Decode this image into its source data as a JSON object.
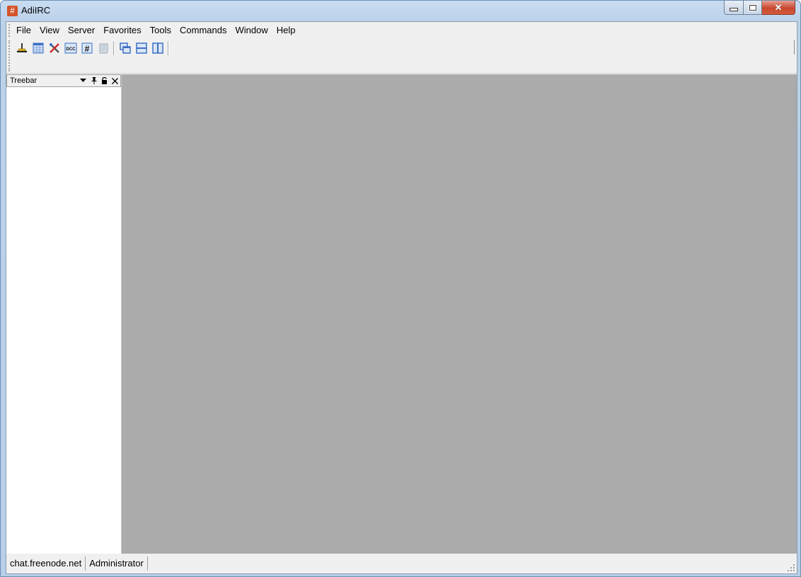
{
  "window": {
    "title": "AdiIRC",
    "app_icon_glyph": "#",
    "caption_buttons": {
      "minimize": "minimize",
      "maximize": "maximize",
      "close": "✕"
    }
  },
  "menubar": {
    "items": [
      "File",
      "View",
      "Server",
      "Favorites",
      "Tools",
      "Commands",
      "Window",
      "Help"
    ]
  },
  "toolbar": {
    "buttons": [
      {
        "name": "connect",
        "icon": "connect-plug-icon"
      },
      {
        "name": "server-list",
        "icon": "server-list-icon"
      },
      {
        "name": "options",
        "icon": "tools-icon"
      },
      {
        "name": "dcc",
        "icon": "dcc-icon",
        "glyph": "DCC"
      },
      {
        "name": "channel-list",
        "icon": "channel-list-icon",
        "glyph": "#"
      },
      {
        "name": "log",
        "icon": "log-scroll-icon"
      },
      {
        "name": "cascade",
        "icon": "cascade-windows-icon"
      },
      {
        "name": "tile-horizontal",
        "icon": "tile-horizontal-icon"
      },
      {
        "name": "tile-vertical",
        "icon": "tile-vertical-icon"
      }
    ]
  },
  "treebar": {
    "title": "Treebar",
    "icons": {
      "dropdown": "▼",
      "pin": "pin",
      "lock": "lock",
      "close": "✕"
    }
  },
  "statusbar": {
    "server": "chat.freenode.net",
    "user": "Administrator"
  },
  "colors": {
    "mdi_background": "#ababab",
    "app_icon": "#d3532a",
    "close_button": "#c9472e"
  }
}
